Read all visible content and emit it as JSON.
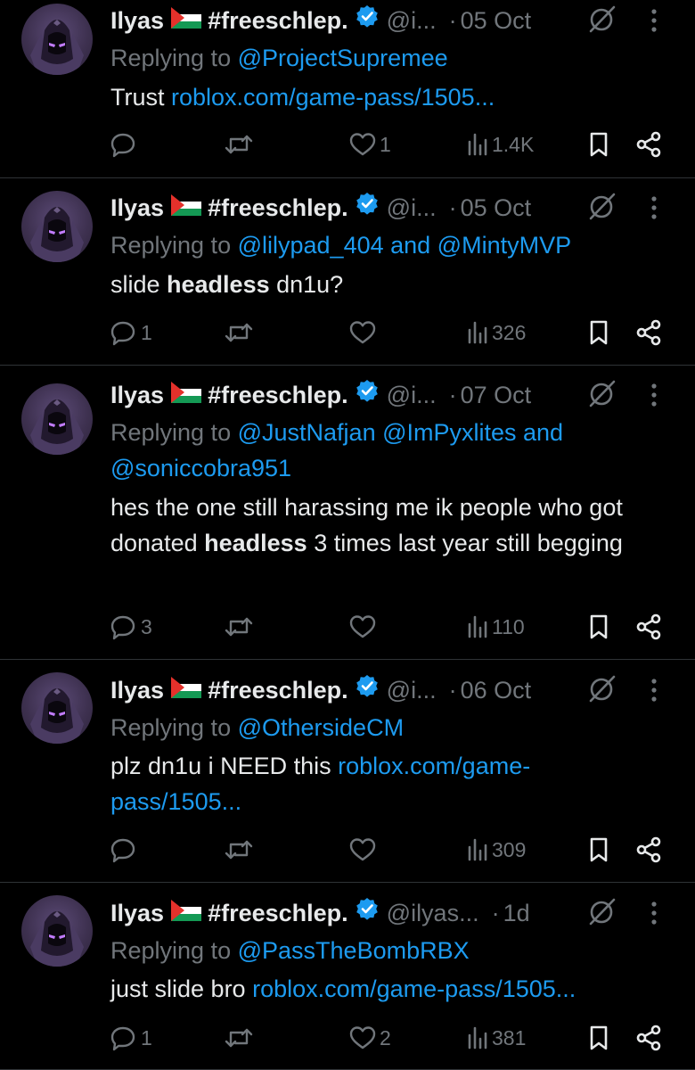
{
  "tweets": [
    {
      "name": "Ilyas",
      "tag": "#freeschlep.",
      "handle": "@i...",
      "separator": "·",
      "time": "05 Oct",
      "replying_label": "Replying to",
      "replying_to": "@ProjectSupremee",
      "text_parts": [
        {
          "t": "Trust "
        },
        {
          "t": "roblox.com/game-pass/1505...",
          "link": true
        }
      ],
      "replies": "",
      "likes": "1",
      "views": "1.4K"
    },
    {
      "name": "Ilyas",
      "tag": "#freeschlep.",
      "handle": "@i...",
      "separator": "·",
      "time": "05 Oct",
      "replying_label": "Replying to",
      "replying_to": "@lilypad_404 and @MintyMVP",
      "text_parts": [
        {
          "t": "slide "
        },
        {
          "t": "headless",
          "bold": true
        },
        {
          "t": " dn1u?"
        }
      ],
      "replies": "1",
      "likes": "",
      "views": "326"
    },
    {
      "name": "Ilyas",
      "tag": "#freeschlep.",
      "handle": "@i...",
      "separator": "·",
      "time": "07 Oct",
      "replying_label": "Replying to",
      "replying_to": "@JustNafjan @ImPyxlites and @soniccobra951",
      "text_parts": [
        {
          "t": "hes the one still harassing me ik people who got donated "
        },
        {
          "t": "headless",
          "bold": true
        },
        {
          "t": " 3 times last year still begging"
        }
      ],
      "replies": "3",
      "likes": "",
      "views": "110"
    },
    {
      "name": "Ilyas",
      "tag": "#freeschlep.",
      "handle": "@i...",
      "separator": "·",
      "time": "06 Oct",
      "replying_label": "Replying to",
      "replying_to": "@OthersideCM",
      "text_parts": [
        {
          "t": "plz dn1u i NEED this "
        },
        {
          "t": "roblox.com/game-pass/1505...",
          "link": true
        }
      ],
      "replies": "",
      "likes": "",
      "views": "309"
    },
    {
      "name": "Ilyas",
      "tag": "#freeschlep.",
      "handle": "@ilyas...",
      "separator": "·",
      "time": "1d",
      "replying_label": "Replying to",
      "replying_to": "@PassTheBombRBX",
      "text_parts": [
        {
          "t": "just slide bro "
        },
        {
          "t": "roblox.com/game-pass/1505...",
          "link": true
        }
      ],
      "replies": "1",
      "likes": "2",
      "views": "381"
    }
  ],
  "colors": {
    "background": "#000000",
    "text": "#e7e9ea",
    "muted": "#71767b",
    "accent": "#1d9bf0",
    "divider": "#2f3336"
  },
  "icons": [
    "avatar",
    "palestine-flag-icon",
    "verified-badge-icon",
    "grok-icon",
    "more-icon",
    "reply-icon",
    "retweet-icon",
    "like-icon",
    "views-icon",
    "bookmark-icon",
    "share-icon"
  ]
}
